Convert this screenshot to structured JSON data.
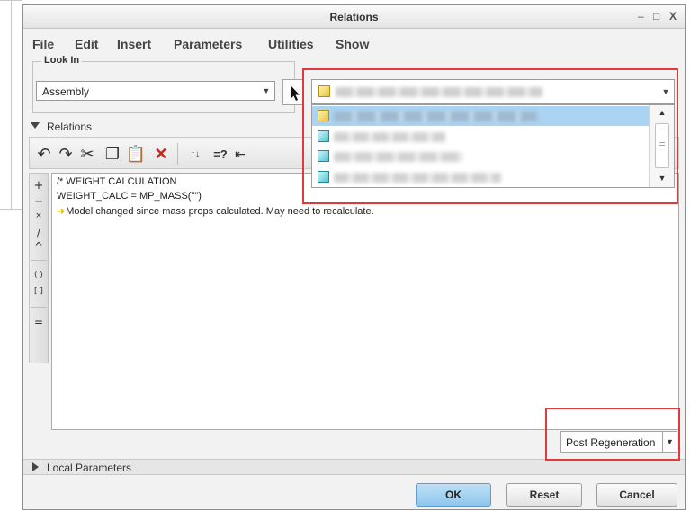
{
  "window": {
    "title": "Relations",
    "controls": [
      "–",
      "□",
      "X"
    ]
  },
  "menu": [
    "File",
    "Edit",
    "Insert",
    "Parameters",
    "Utilities",
    "Show"
  ],
  "look_in": {
    "legend": "Look In",
    "value": "Assembly",
    "model_icon": "assembly-icon"
  },
  "model_dropdown": {
    "items": [
      {
        "icon": "assembly-icon",
        "selected": true
      },
      {
        "icon": "part-icon",
        "selected": false
      },
      {
        "icon": "part-icon",
        "selected": false
      },
      {
        "icon": "part-icon",
        "selected": false
      }
    ]
  },
  "relations": {
    "label": "Relations",
    "toolbar_icons": [
      "undo-icon",
      "redo-icon",
      "cut-icon",
      "copy-icon",
      "paste-icon",
      "delete-icon",
      "evaluate-icon",
      "verify-icon",
      "sort-icon"
    ],
    "operators": [
      "+",
      "−",
      "×",
      "/",
      "^",
      "( )",
      "[ ]",
      "="
    ],
    "lines": [
      "/* WEIGHT CALCULATION",
      "WEIGHT_CALC = MP_MASS(\"\")",
      "Model changed since mass props calculated. May need to recalculate."
    ]
  },
  "regen_option": {
    "value": "Post Regeneration"
  },
  "local_parameters": {
    "label": "Local Parameters"
  },
  "buttons": {
    "ok": "OK",
    "reset": "Reset",
    "cancel": "Cancel"
  },
  "colors": {
    "accent": "#8ec6ee",
    "highlight": "#e0393e",
    "selection": "#aad4f2"
  }
}
